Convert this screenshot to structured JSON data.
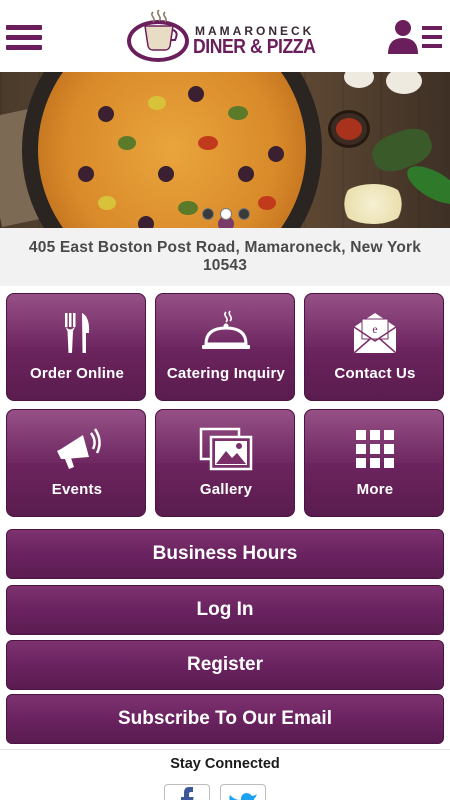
{
  "header": {
    "logo_line1": "MAMARONECK",
    "logo_line2": "DINER & PIZZA",
    "menu_icon": "hamburger-icon",
    "account_icon": "user-list-icon"
  },
  "hero": {
    "slides_total": 3,
    "active_slide": 2
  },
  "address": "405 East Boston Post Road, Mamaroneck, New York 10543",
  "tiles": [
    {
      "label": "Order Online",
      "icon": "fork-knife-icon"
    },
    {
      "label": "Catering Inquiry",
      "icon": "serving-dish-icon"
    },
    {
      "label": "Contact Us",
      "icon": "envelope-icon"
    },
    {
      "label": "Events",
      "icon": "megaphone-icon"
    },
    {
      "label": "Gallery",
      "icon": "gallery-icon"
    },
    {
      "label": "More",
      "icon": "grid-icon"
    }
  ],
  "buttons": {
    "business_hours": "Business Hours",
    "login": "Log In",
    "register": "Register",
    "subscribe": "Subscribe To Our Email"
  },
  "footer": {
    "stay_connected": "Stay Connected",
    "social_icons": [
      "facebook-icon",
      "twitter-icon"
    ]
  },
  "colors": {
    "brand_purple": "#6a2360",
    "address_text": "#4a4a4a"
  }
}
